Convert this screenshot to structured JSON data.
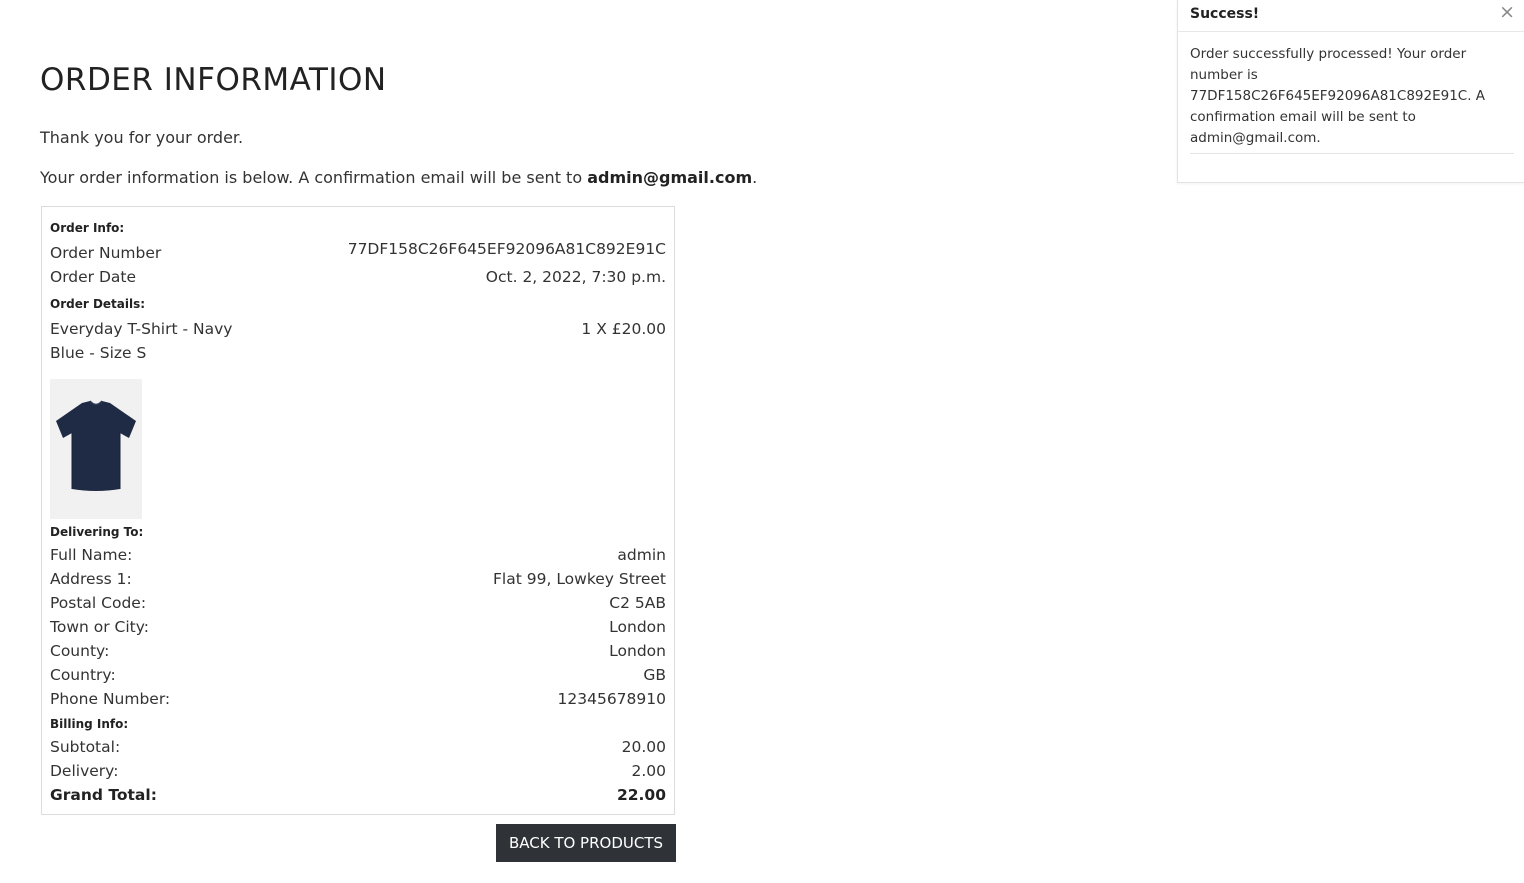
{
  "page": {
    "title": "ORDER INFORMATION",
    "thanks": "Thank you for your order.",
    "info_prefix": "Your order information is below. A confirmation email will be sent to ",
    "email": "admin@gmail.com",
    "info_suffix": "."
  },
  "order_info": {
    "label": "Order Info:",
    "rows": [
      {
        "label": "Order Number",
        "value": "77DF158C26F645EF92096A81C892E91C"
      },
      {
        "label": "Order Date",
        "value": "Oct. 2, 2022, 7:30 p.m."
      }
    ]
  },
  "order_details": {
    "label": "Order Details:",
    "item_name": "Everyday T-Shirt - Navy Blue - Size S",
    "item_qty": "1 X £20.00",
    "image_icon": "navy-tshirt-image"
  },
  "delivering": {
    "label": "Delivering To:",
    "rows": [
      {
        "label": "Full Name:",
        "value": "admin"
      },
      {
        "label": "Address 1:",
        "value": "Flat 99, Lowkey Street"
      },
      {
        "label": "Postal Code:",
        "value": "C2 5AB"
      },
      {
        "label": "Town or City:",
        "value": "London"
      },
      {
        "label": "County:",
        "value": "London"
      },
      {
        "label": "Country:",
        "value": "GB"
      },
      {
        "label": "Phone Number:",
        "value": "12345678910"
      }
    ]
  },
  "billing": {
    "label": "Billing Info:",
    "rows": [
      {
        "label": "Subtotal:",
        "value": "20.00"
      },
      {
        "label": "Delivery:",
        "value": "2.00"
      }
    ],
    "grand_label": "Grand Total:",
    "grand_value": "22.00"
  },
  "back_button": "BACK TO PRODUCTS",
  "toast": {
    "title": "Success!",
    "close": "×",
    "message": "Order successfully processed! Your order number is 77DF158C26F645EF92096A81C892E91C. A confirmation email will be sent to admin@gmail.com."
  },
  "colors": {
    "button_bg": "#2f3338",
    "tshirt": "#1f2a44"
  }
}
